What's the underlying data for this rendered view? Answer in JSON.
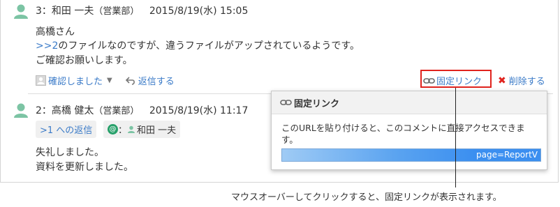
{
  "comment1": {
    "number": "3",
    "separator": "：",
    "author": "和田 一夫",
    "dept": "（営業部）",
    "date": "2015/8/19(水) 15:05",
    "line1": "高橋さん",
    "ref_link": ">>2",
    "line2_rest": "のファイルなのですが、違うファイルがアップされているようです。",
    "line3": "ご確認お願いします。",
    "confirm_label": "確認しました",
    "reply_label": "返信する",
    "permalink_label": "固定リンク",
    "delete_label": "削除する"
  },
  "comment2": {
    "number": "2",
    "separator": "：",
    "author": "高橋 健太",
    "dept": "（営業部）",
    "date": "2015/8/19(水) 11:17",
    "reply_tag": ">1 への返信",
    "mention_colon": "：",
    "mention_user": "和田 一夫",
    "line1": "失礼しました。",
    "line2": "資料を更新しました。"
  },
  "popup": {
    "title": "固定リンク",
    "description": "このURLを貼り付けると、このコメントに直接アクセスできます。",
    "url_tail": "page=ReportV"
  },
  "caption": "マウスオーバーしてクリックすると、固定リンクが表示されます。",
  "colors": {
    "link": "#3b7bc8",
    "avatar": "#7cc4a4",
    "highlight": "#e0231d",
    "url_select": "#3b8ff0"
  }
}
